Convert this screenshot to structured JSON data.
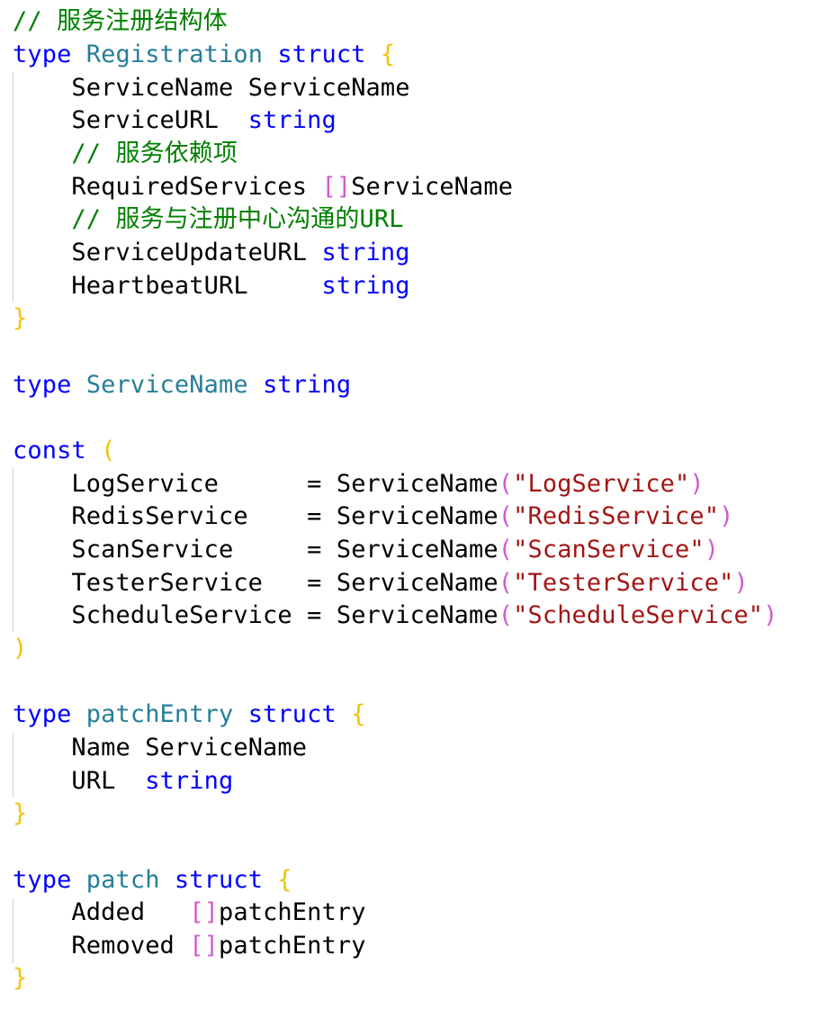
{
  "code": {
    "language": "go",
    "comment_registration": "// 服务注册结构体",
    "kw_type": "type",
    "kw_struct": "struct",
    "kw_const": "const",
    "kw_string": "string",
    "brace_open": "{",
    "brace_close": "}",
    "paren_open": "(",
    "paren_close": ")",
    "slice_brackets": "[]",
    "registration": {
      "name": "Registration",
      "f1_name": "ServiceName",
      "f1_type": "ServiceName",
      "f2_name": "ServiceURL",
      "comment_deps": "// 服务依赖项",
      "f3_name": "RequiredServices",
      "f3_type": "ServiceName",
      "comment_url": "// 服务与注册中心沟通的URL",
      "f4_name": "ServiceUpdateURL",
      "f5_name": "HeartbeatURL"
    },
    "servicename_type": "ServiceName",
    "consts": [
      {
        "name": "LogService",
        "value": "\"LogService\""
      },
      {
        "name": "RedisService",
        "value": "\"RedisService\""
      },
      {
        "name": "ScanService",
        "value": "\"ScanService\""
      },
      {
        "name": "TesterService",
        "value": "\"TesterService\""
      },
      {
        "name": "ScheduleService",
        "value": "\"ScheduleService\""
      }
    ],
    "const_equals": "=",
    "const_ctor": "ServiceName",
    "patch_entry": {
      "name": "patchEntry",
      "f1_name": "Name",
      "f1_type": "ServiceName",
      "f2_name": "URL"
    },
    "patch": {
      "name": "patch",
      "f1_name": "Added",
      "f1_type": "patchEntry",
      "f2_name": "Removed",
      "f2_type": "patchEntry"
    }
  },
  "colors": {
    "keyword": "#0000ff",
    "type_name": "#267f99",
    "comment": "#008000",
    "string": "#a31515",
    "bracket_level1": "#f2c200",
    "bracket_level2": "#d05ad0"
  }
}
